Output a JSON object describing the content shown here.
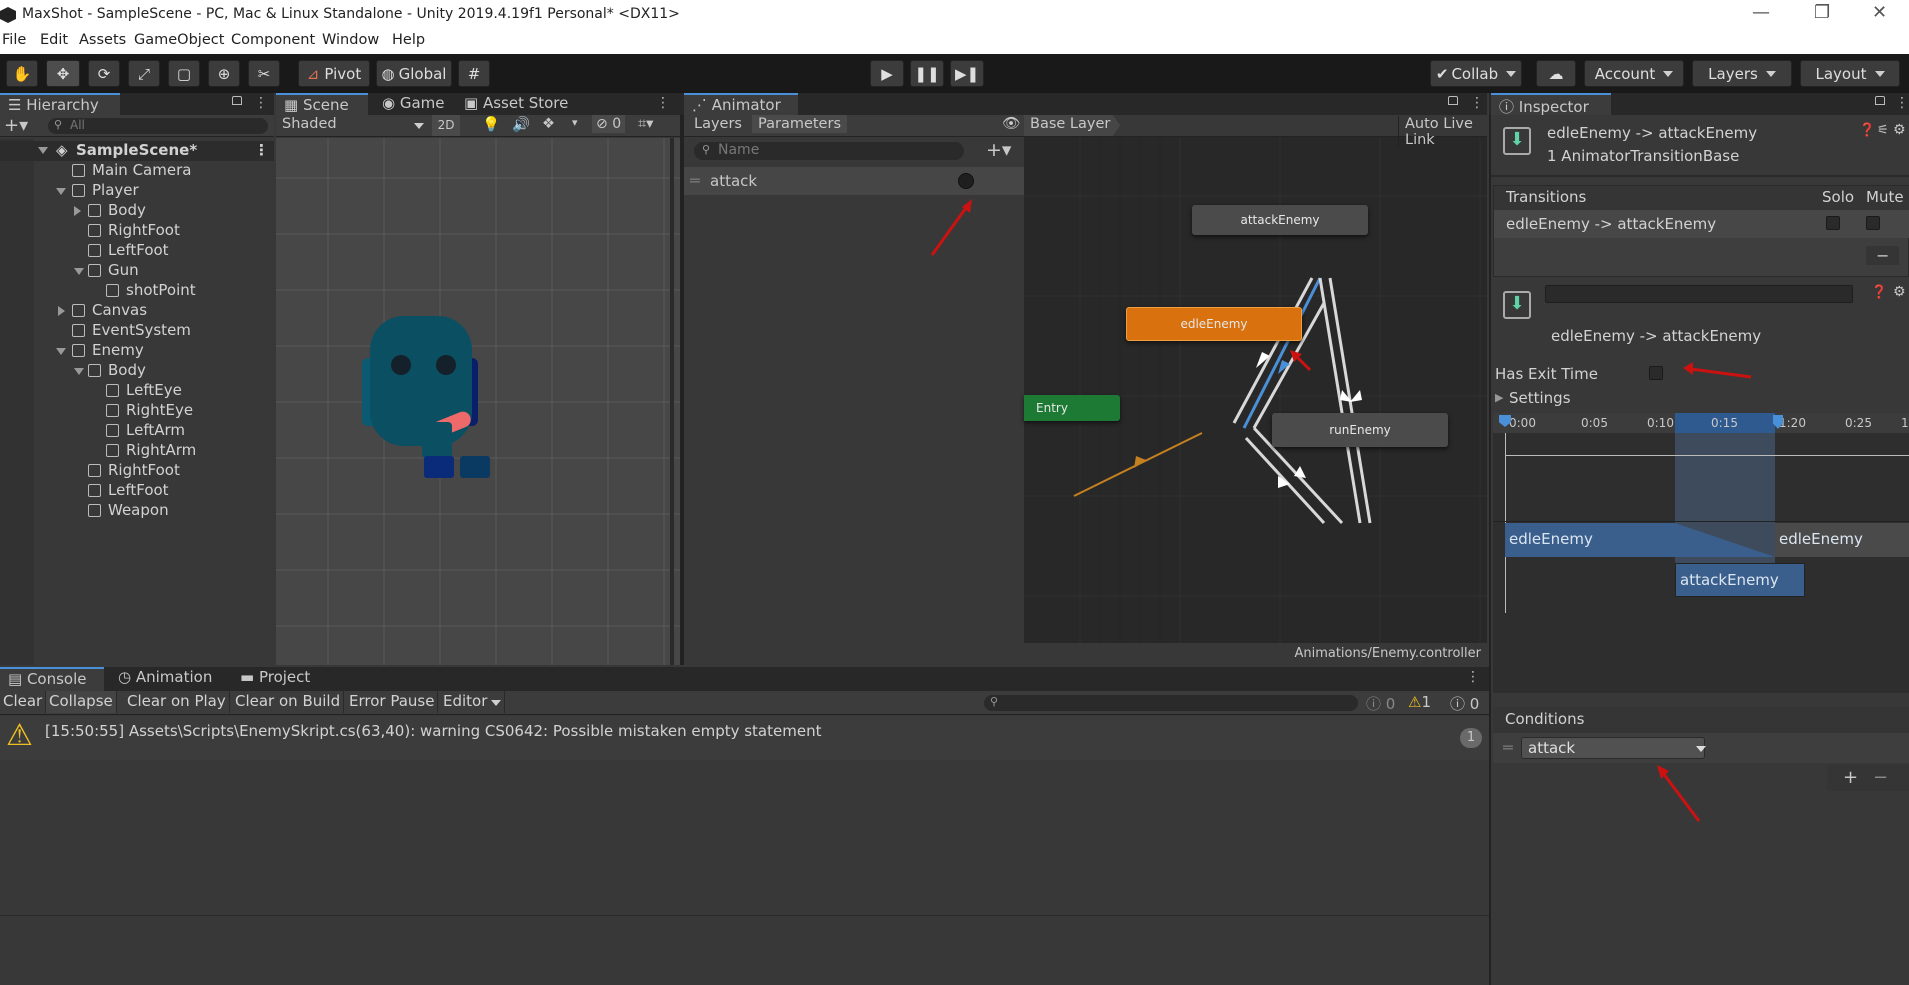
{
  "window": {
    "title": "MaxShot - SampleScene - PC, Mac & Linux Standalone - Unity 2019.4.19f1 Personal* <DX11>",
    "minimize": "—",
    "maximize": "❐",
    "close": "✕"
  },
  "menu": [
    "File",
    "Edit",
    "Assets",
    "GameObject",
    "Component",
    "Window",
    "Help"
  ],
  "toolbar": {
    "pivot": "Pivot",
    "global": "Global",
    "collab": "Collab",
    "account": "Account",
    "layers": "Layers",
    "layout": "Layout"
  },
  "hierarchy": {
    "tab": "Hierarchy",
    "search_placeholder": "All",
    "rows": [
      "SampleScene*",
      "Main Camera",
      "Player",
      "Body",
      "RightFoot",
      "LeftFoot",
      "Gun",
      "shotPoint",
      "Canvas",
      "EventSystem",
      "Enemy",
      "Body",
      "LeftEye",
      "RightEye",
      "LeftArm",
      "RightArm",
      "RightFoot",
      "LeftFoot",
      "Weapon"
    ]
  },
  "scene": {
    "tabs": [
      "Scene",
      "Game",
      "Asset Store"
    ],
    "shading": "Shaded",
    "mode_2d": "2D",
    "hidden_count": "0"
  },
  "animator": {
    "tab": "Animator",
    "layers_tab": "Layers",
    "parameters_tab": "Parameters",
    "search_placeholder": "Name",
    "parameter": "attack",
    "breadcrumb": "Base Layer",
    "auto_live": "Auto Live Link",
    "path": "Animations/Enemy.controller",
    "states": {
      "attack": "attackEnemy",
      "idle": "edleEnemy",
      "entry": "Entry",
      "run": "runEnemy"
    }
  },
  "inspector": {
    "tab": "Inspector",
    "header_title": "edleEnemy -> attackEnemy",
    "header_sub": "1 AnimatorTransitionBase",
    "transitions_label": "Transitions",
    "solo": "Solo",
    "mute": "Mute",
    "transition_row": "edleEnemy -> attackEnemy",
    "transition_name": "edleEnemy -> attackEnemy",
    "has_exit_time": "Has Exit Time",
    "settings": "Settings",
    "timeline_ticks": [
      "0:00",
      "0:05",
      "0:10",
      "0:15",
      "1:20",
      "0:25",
      "1:"
    ],
    "clip_a": "edleEnemy",
    "clip_a2": "edleEnemy",
    "clip_b": "attackEnemy",
    "conditions": "Conditions",
    "condition_value": "attack",
    "minus": "−",
    "plus": "+"
  },
  "console": {
    "tabs": [
      "Console",
      "Animation",
      "Project"
    ],
    "buttons": [
      "Clear",
      "Collapse",
      "Clear on Play",
      "Clear on Build",
      "Error Pause",
      "Editor"
    ],
    "count_err": "0",
    "count_warn": "1",
    "count_info": "0",
    "message": "[15:50:55] Assets\\Scripts\\EnemySkript.cs(63,40): warning CS0642: Possible mistaken empty statement",
    "message_count": "1"
  }
}
